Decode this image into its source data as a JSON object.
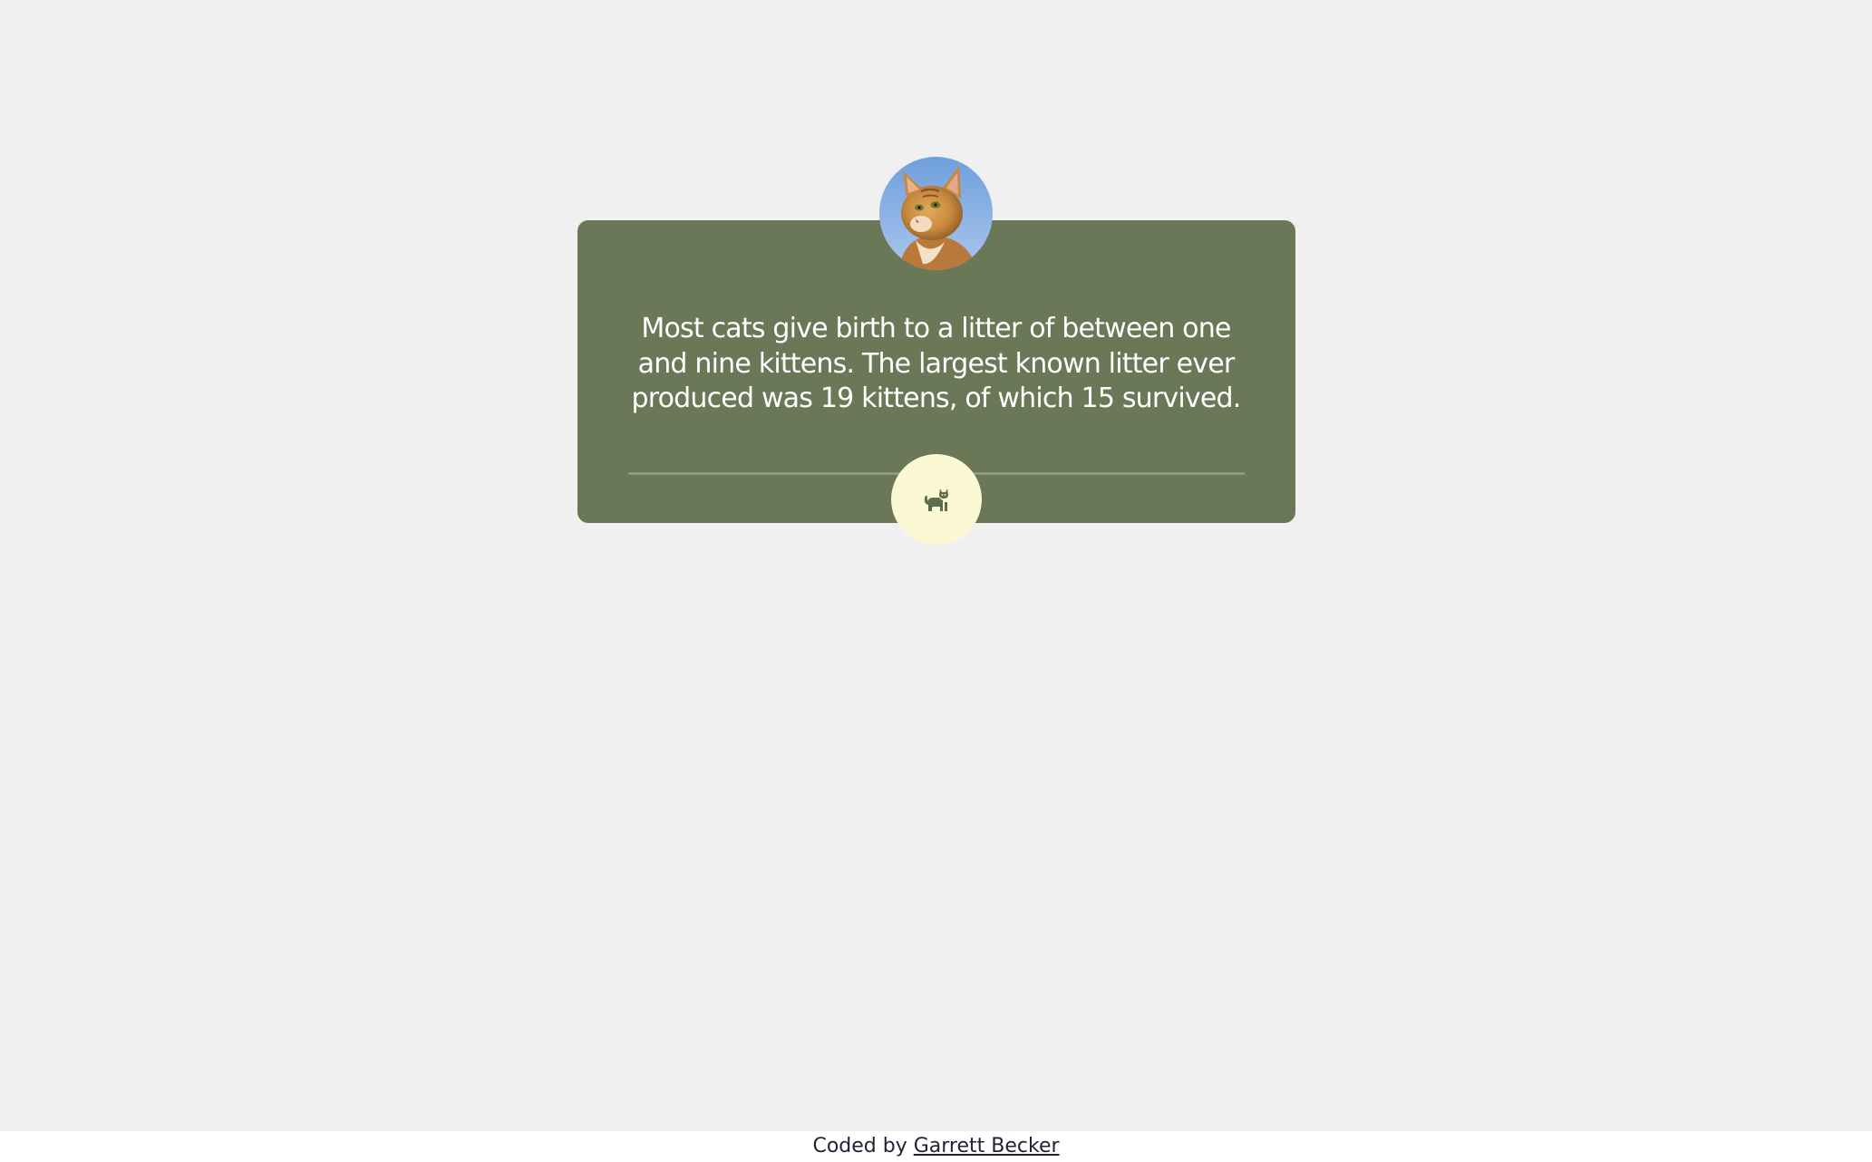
{
  "quote_card": {
    "avatar_alt": "orange-tabby-cat-photo",
    "text": "Most cats give birth to a litter of between one and nine kittens. The largest known litter ever produced was 19 kittens, of which 15 survived.",
    "action_icon": "cat-icon"
  },
  "footer": {
    "prefix": "Coded by",
    "author_link": "Garrett Becker"
  },
  "colors": {
    "page_background": "#f0f0f0",
    "card_background": "#6a7857",
    "divider": "#8d9a7b",
    "button_background": "#fcf8d3",
    "button_icon": "#5f6d4f",
    "footer_background": "#ffffff",
    "footer_text": "#1e2233"
  }
}
